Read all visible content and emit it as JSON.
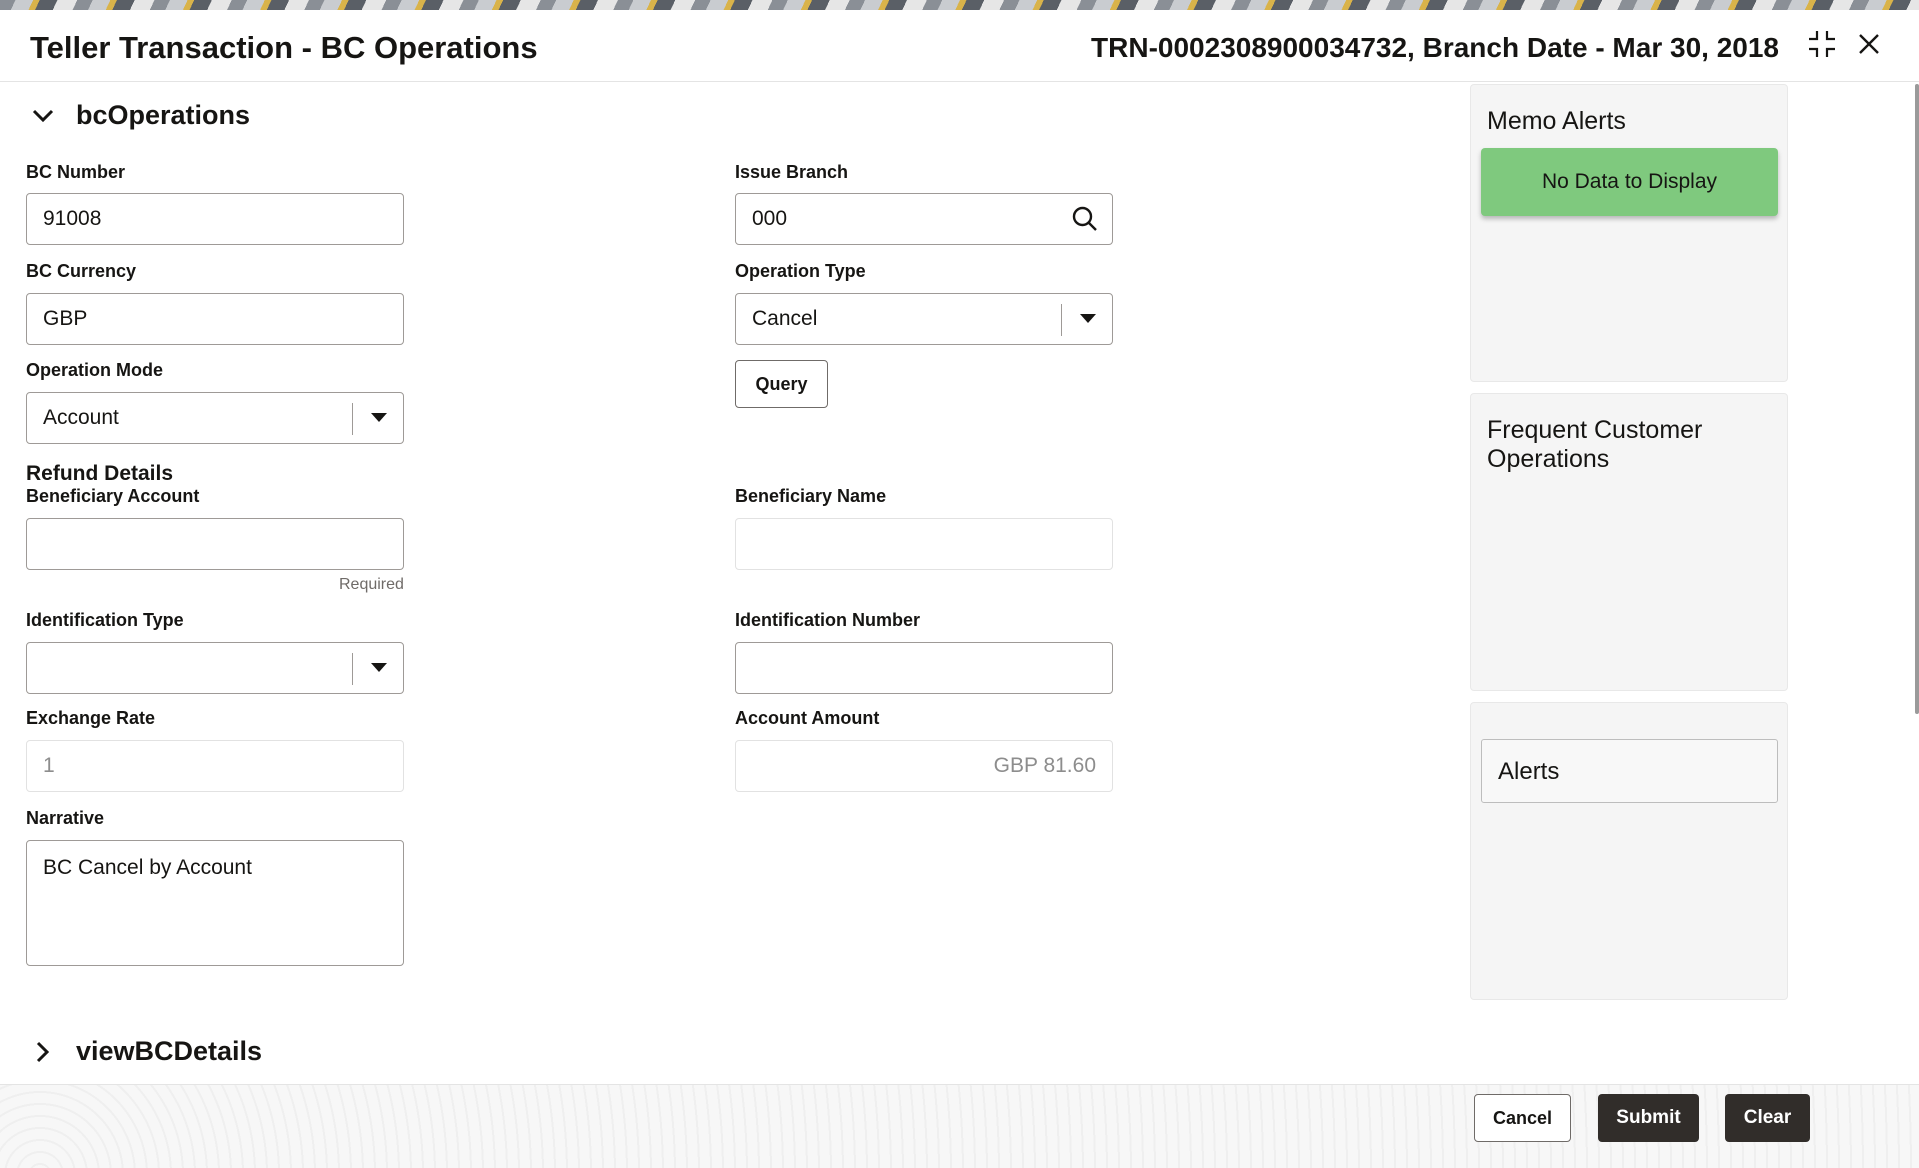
{
  "header": {
    "title": "Teller Transaction - BC Operations",
    "transaction_info": "TRN-0002308900034732, Branch Date - Mar 30, 2018",
    "collapse_icon": "collapse-icon",
    "close_icon": "close-icon"
  },
  "sections": {
    "bc_operations": "bcOperations",
    "view_bc_details": "viewBCDetails"
  },
  "form": {
    "bc_number": {
      "label": "BC Number",
      "value": "91008"
    },
    "issue_branch": {
      "label": "Issue Branch",
      "value": "000"
    },
    "bc_currency": {
      "label": "BC Currency",
      "value": "GBP"
    },
    "operation_type": {
      "label": "Operation Type",
      "value": "Cancel"
    },
    "query_label": "Query",
    "operation_mode": {
      "label": "Operation Mode",
      "value": "Account"
    },
    "refund_details": "Refund Details",
    "beneficiary_account": {
      "label": "Beneficiary Account",
      "value": "",
      "hint": "Required"
    },
    "beneficiary_name": {
      "label": "Beneficiary Name",
      "value": ""
    },
    "identification_type": {
      "label": "Identification Type",
      "value": ""
    },
    "identification_number": {
      "label": "Identification Number",
      "value": ""
    },
    "exchange_rate": {
      "label": "Exchange Rate",
      "value": "1"
    },
    "account_amount": {
      "label": "Account Amount",
      "value": "GBP 81.60"
    },
    "narrative": {
      "label": "Narrative",
      "value": "BC Cancel by Account"
    }
  },
  "sidebar": {
    "memo_alerts": {
      "title": "Memo Alerts",
      "empty_text": "No Data to Display",
      "empty_color": "#7fc97e"
    },
    "frequent_ops": {
      "title": "Frequent Customer Operations"
    },
    "alerts": {
      "label": "Alerts"
    }
  },
  "footer": {
    "cancel_label": "Cancel",
    "submit_label": "Submit",
    "clear_label": "Clear"
  }
}
